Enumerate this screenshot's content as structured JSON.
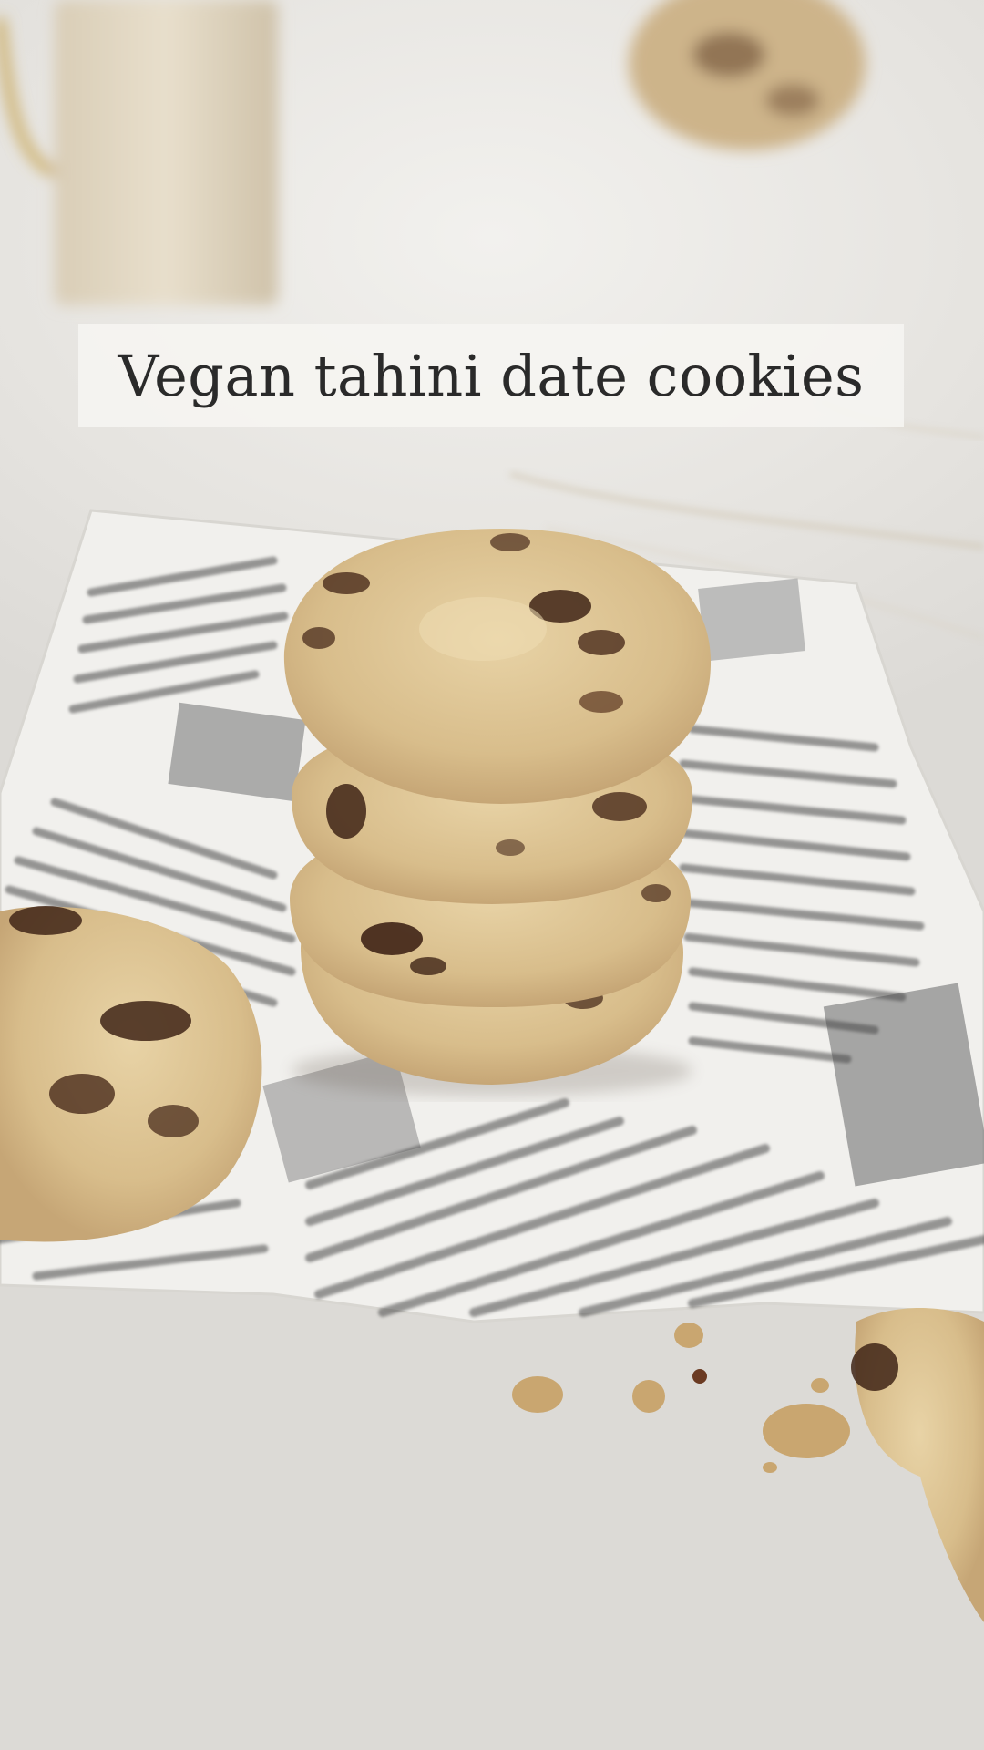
{
  "overlay": {
    "title": "Vegan tahini date cookies"
  },
  "scene": {
    "subject": "cookies-on-newspaper",
    "colors": {
      "background": "#e6e4e0",
      "paper": "#f4f3f0",
      "cookie": "#d9bf8f",
      "chocolate": "#4a2c1c",
      "newsprint": "#3a3a3a"
    }
  }
}
